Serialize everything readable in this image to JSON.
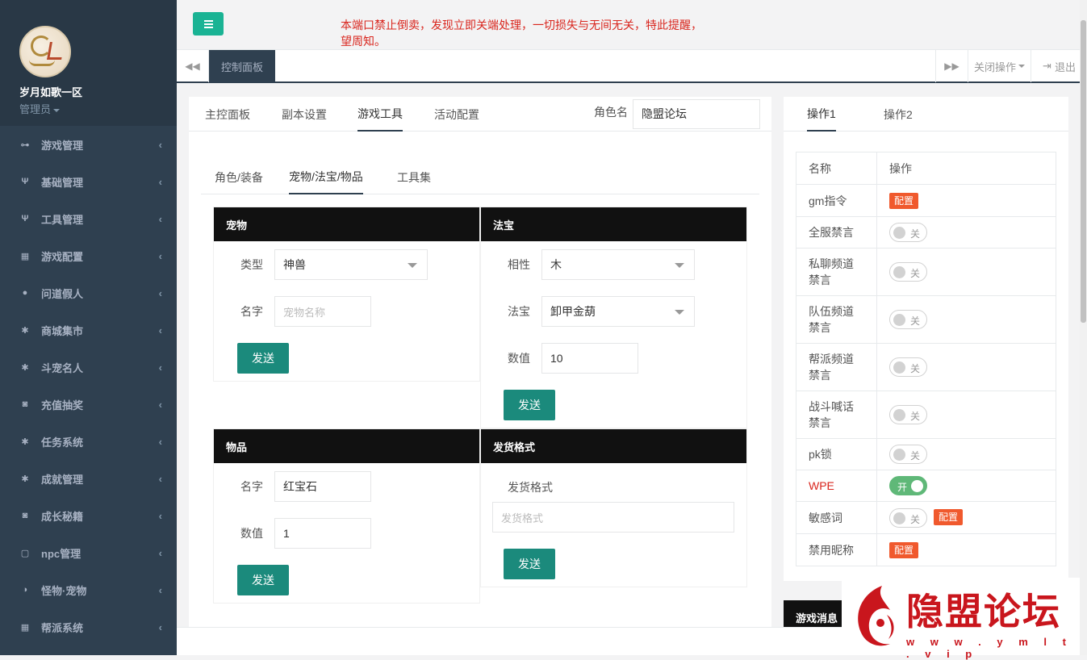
{
  "sidebar": {
    "username": "岁月如歌一区",
    "role": "管理员",
    "items": [
      {
        "label": "游戏管理",
        "icon": "gamepad-icon"
      },
      {
        "label": "基础管理",
        "icon": "cutlery-icon"
      },
      {
        "label": "工具管理",
        "icon": "cutlery-icon"
      },
      {
        "label": "游戏配置",
        "icon": "table-icon"
      },
      {
        "label": "问道假人",
        "icon": "user-icon"
      },
      {
        "label": "商城集市",
        "icon": "asterisk-icon"
      },
      {
        "label": "斗宠名人",
        "icon": "asterisk-icon"
      },
      {
        "label": "充值抽奖",
        "icon": "camera-icon"
      },
      {
        "label": "任务系统",
        "icon": "asterisk-icon"
      },
      {
        "label": "成就管理",
        "icon": "asterisk-icon"
      },
      {
        "label": "成长秘籍",
        "icon": "camera-icon"
      },
      {
        "label": "npc管理",
        "icon": "square-icon"
      },
      {
        "label": "怪物·宠物",
        "icon": "half-circle-icon"
      },
      {
        "label": "帮派系统",
        "icon": "table-icon"
      }
    ]
  },
  "header": {
    "notice": "本端口禁止倒卖，发现立即关端处理，一切损失与无间无关，特此提醒，望周知。"
  },
  "tabbar": {
    "active_tab": "控制面板",
    "close_ops": "关闭操作",
    "logout": "退出"
  },
  "main": {
    "top_tabs": [
      "主控面板",
      "副本设置",
      "游戏工具",
      "活动配置"
    ],
    "role_label": "角色名",
    "role_value": "隐盟论坛",
    "sub_tabs": [
      "角色/装备",
      "宠物/法宝/物品",
      "工具集"
    ],
    "pet": {
      "title": "宠物",
      "type_label": "类型",
      "type_value": "神兽",
      "name_label": "名字",
      "name_placeholder": "宠物名称",
      "send": "发送"
    },
    "treasure": {
      "title": "法宝",
      "attr_label": "相性",
      "attr_value": "木",
      "item_label": "法宝",
      "item_value": "卸甲金葫",
      "num_label": "数值",
      "num_value": "10",
      "send": "发送"
    },
    "item": {
      "title": "物品",
      "name_label": "名字",
      "name_value": "红宝石",
      "num_label": "数值",
      "num_value": "1",
      "send": "发送"
    },
    "ship": {
      "title": "发货格式",
      "label": "发货格式",
      "placeholder": "发货格式",
      "send": "发送"
    }
  },
  "right": {
    "tabs": [
      "操作1",
      "操作2"
    ],
    "col_name": "名称",
    "col_op": "操作",
    "rows": [
      {
        "name": "gm指令",
        "config": "配置"
      },
      {
        "name": "全服禁言",
        "toggle": "关"
      },
      {
        "name": "私聊频道禁言",
        "toggle": "关"
      },
      {
        "name": "队伍频道禁言",
        "toggle": "关"
      },
      {
        "name": "帮派频道禁言",
        "toggle": "关"
      },
      {
        "name": "战斗喊话禁言",
        "toggle": "关"
      },
      {
        "name": "pk锁",
        "toggle": "关"
      },
      {
        "name": "WPE",
        "toggle": "开",
        "highlight": "#d9251d"
      },
      {
        "name": "敏感词",
        "toggle": "关",
        "config": "配置"
      },
      {
        "name": "禁用昵称",
        "config": "配置"
      }
    ],
    "message_box_title": "游戏消息"
  },
  "watermark": {
    "text": "隐盟论坛",
    "url": "w w w . y m l t . v i p"
  },
  "colors": {
    "sidebar_bg": "#2f4050",
    "accent": "#1ab394",
    "send_btn": "#1b8a7c",
    "config_badge": "#f0592d",
    "toggle_on": "#5fb878",
    "notice": "#d9251d"
  }
}
